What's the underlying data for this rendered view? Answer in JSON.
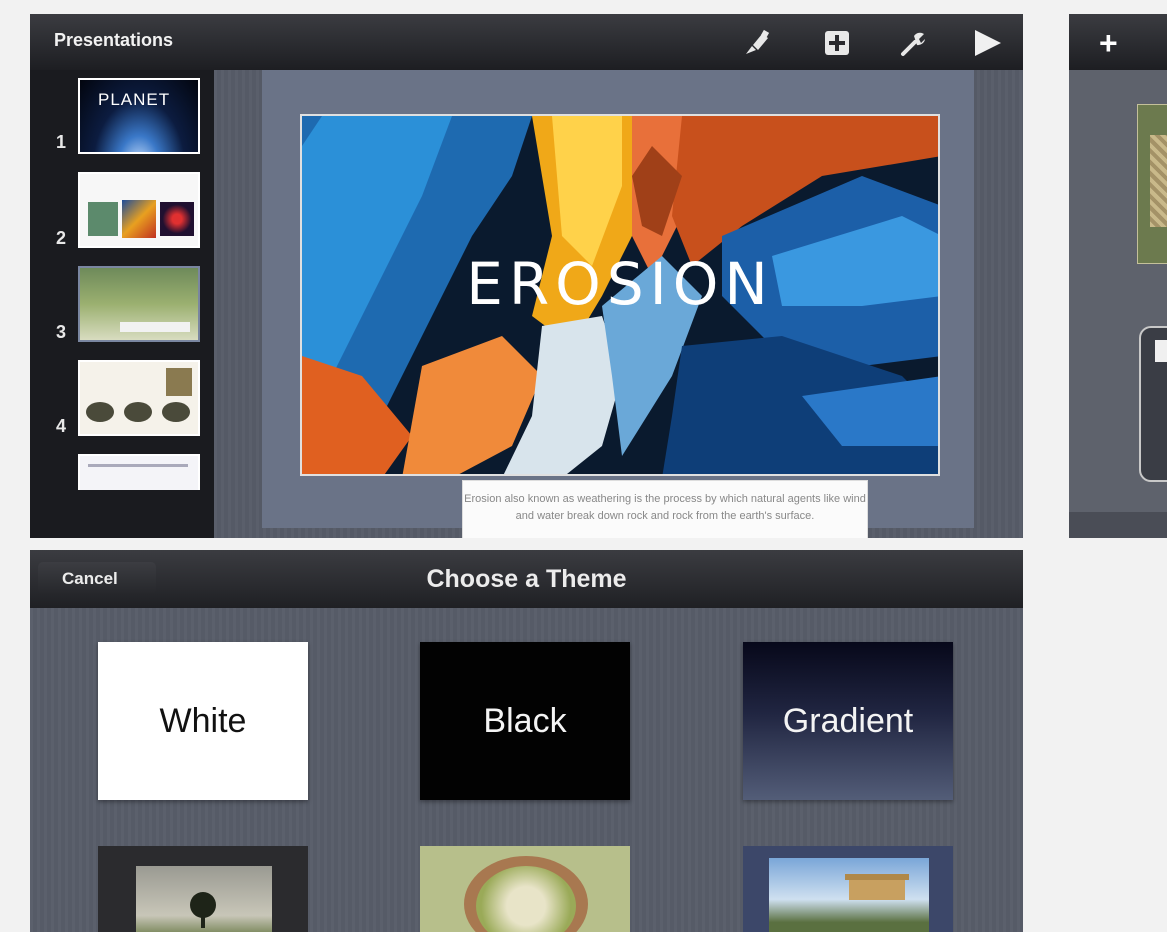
{
  "editor": {
    "title": "Presentations",
    "toolbar": {
      "icons": [
        "paintbrush-icon",
        "insert-icon",
        "wrench-icon",
        "play-icon"
      ]
    },
    "navigator": {
      "slides": [
        {
          "number": "1",
          "label": "PLANET"
        },
        {
          "number": "2",
          "label": ""
        },
        {
          "number": "3",
          "label": ""
        },
        {
          "number": "4",
          "label": ""
        }
      ],
      "add_icon": "add-slide-icon"
    },
    "slide": {
      "title": "EROSION",
      "caption": "Erosion also known as weathering is the process by which natural agents like wind and water break down rock and rock from the earth's surface."
    }
  },
  "side_panel": {
    "plus_label": "+"
  },
  "theme_chooser": {
    "cancel_label": "Cancel",
    "title": "Choose a Theme",
    "themes": [
      {
        "name": "White"
      },
      {
        "name": "Black"
      },
      {
        "name": "Gradient"
      }
    ]
  },
  "colors": {
    "toolbar_dark": "#1d1e22",
    "canvas_gray": "#5a5f6b",
    "stage_blue_gray": "#6a7387"
  }
}
